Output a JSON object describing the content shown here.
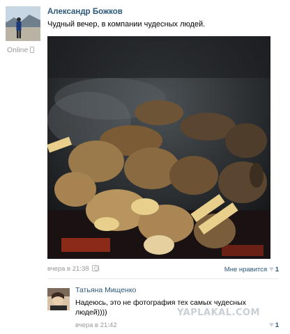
{
  "post": {
    "author": "Александр Божков",
    "status": "Online",
    "text": "Чудный вечер, в компании чудесных людей.",
    "time": "вчера в 21:38",
    "like_label": "Мне нравится",
    "like_count": "1",
    "photo_icon": "camera-icon"
  },
  "comment": {
    "author": "Татьяна Мищенко",
    "text": "Надеюсь, это не фотография тех самых чудесных людей))))",
    "time": "вчера в 21:42",
    "like_count": "1"
  },
  "watermark": "YAPLAKAL.COM",
  "colors": {
    "link": "#2b587a",
    "meta": "#999999",
    "heart": "#c7d4e1"
  }
}
